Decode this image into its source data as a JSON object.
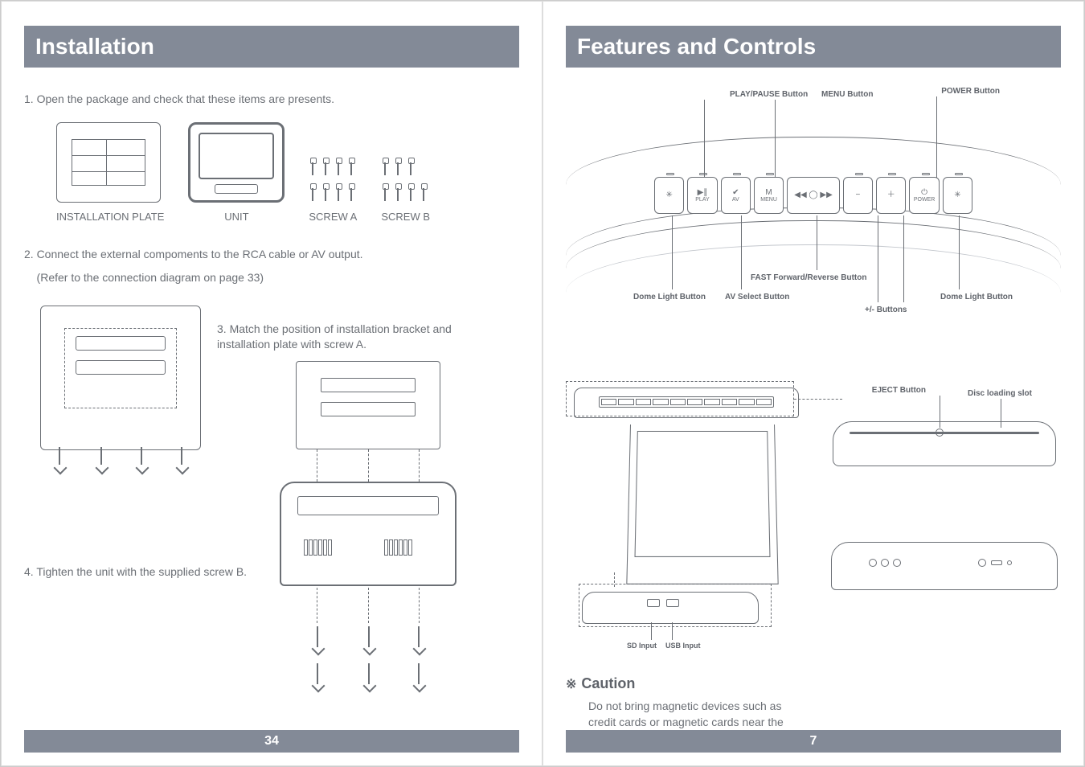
{
  "left": {
    "title": "Installation",
    "step1": "1. Open the package and check that these items are presents.",
    "labels": {
      "plate": "INSTALLATION PLATE",
      "unit": "UNIT",
      "screwA": "SCREW A",
      "screwB": "SCREW B"
    },
    "step2_line1": "2. Connect the external compoments to the RCA cable or AV output.",
    "step2_line2": "    (Refer to the connection diagram on page 33)",
    "step3": "3. Match the position of installation bracket and installation plate with screw A.",
    "step4": "4. Tighten the unit with the supplied screw B.",
    "page_number": "34"
  },
  "right": {
    "title": "Features and Controls",
    "callouts": {
      "play_pause": "PLAY/PAUSE Button",
      "menu": "MENU Button",
      "power": "POWER Button",
      "dome_left": "Dome Light Button",
      "av_select": "AV Select Button",
      "ff_rev": "FAST Forward/Reverse Button",
      "plus_minus": "+/- Buttons",
      "dome_right": "Dome Light Button",
      "eject": "EJECT Button",
      "disc_slot": "Disc loading slot",
      "sd": "SD Input",
      "usb": "USB Input"
    },
    "buttons": {
      "play": "PLAY",
      "av": "AV",
      "menu_small": "M\nMENU",
      "power_small": "POWER"
    },
    "caution_title": "Caution",
    "caution_symbol": "※",
    "caution_text": "Do not bring magnetic devices such as credit cards or magnetic cards near the monitor.",
    "page_number": "7"
  }
}
